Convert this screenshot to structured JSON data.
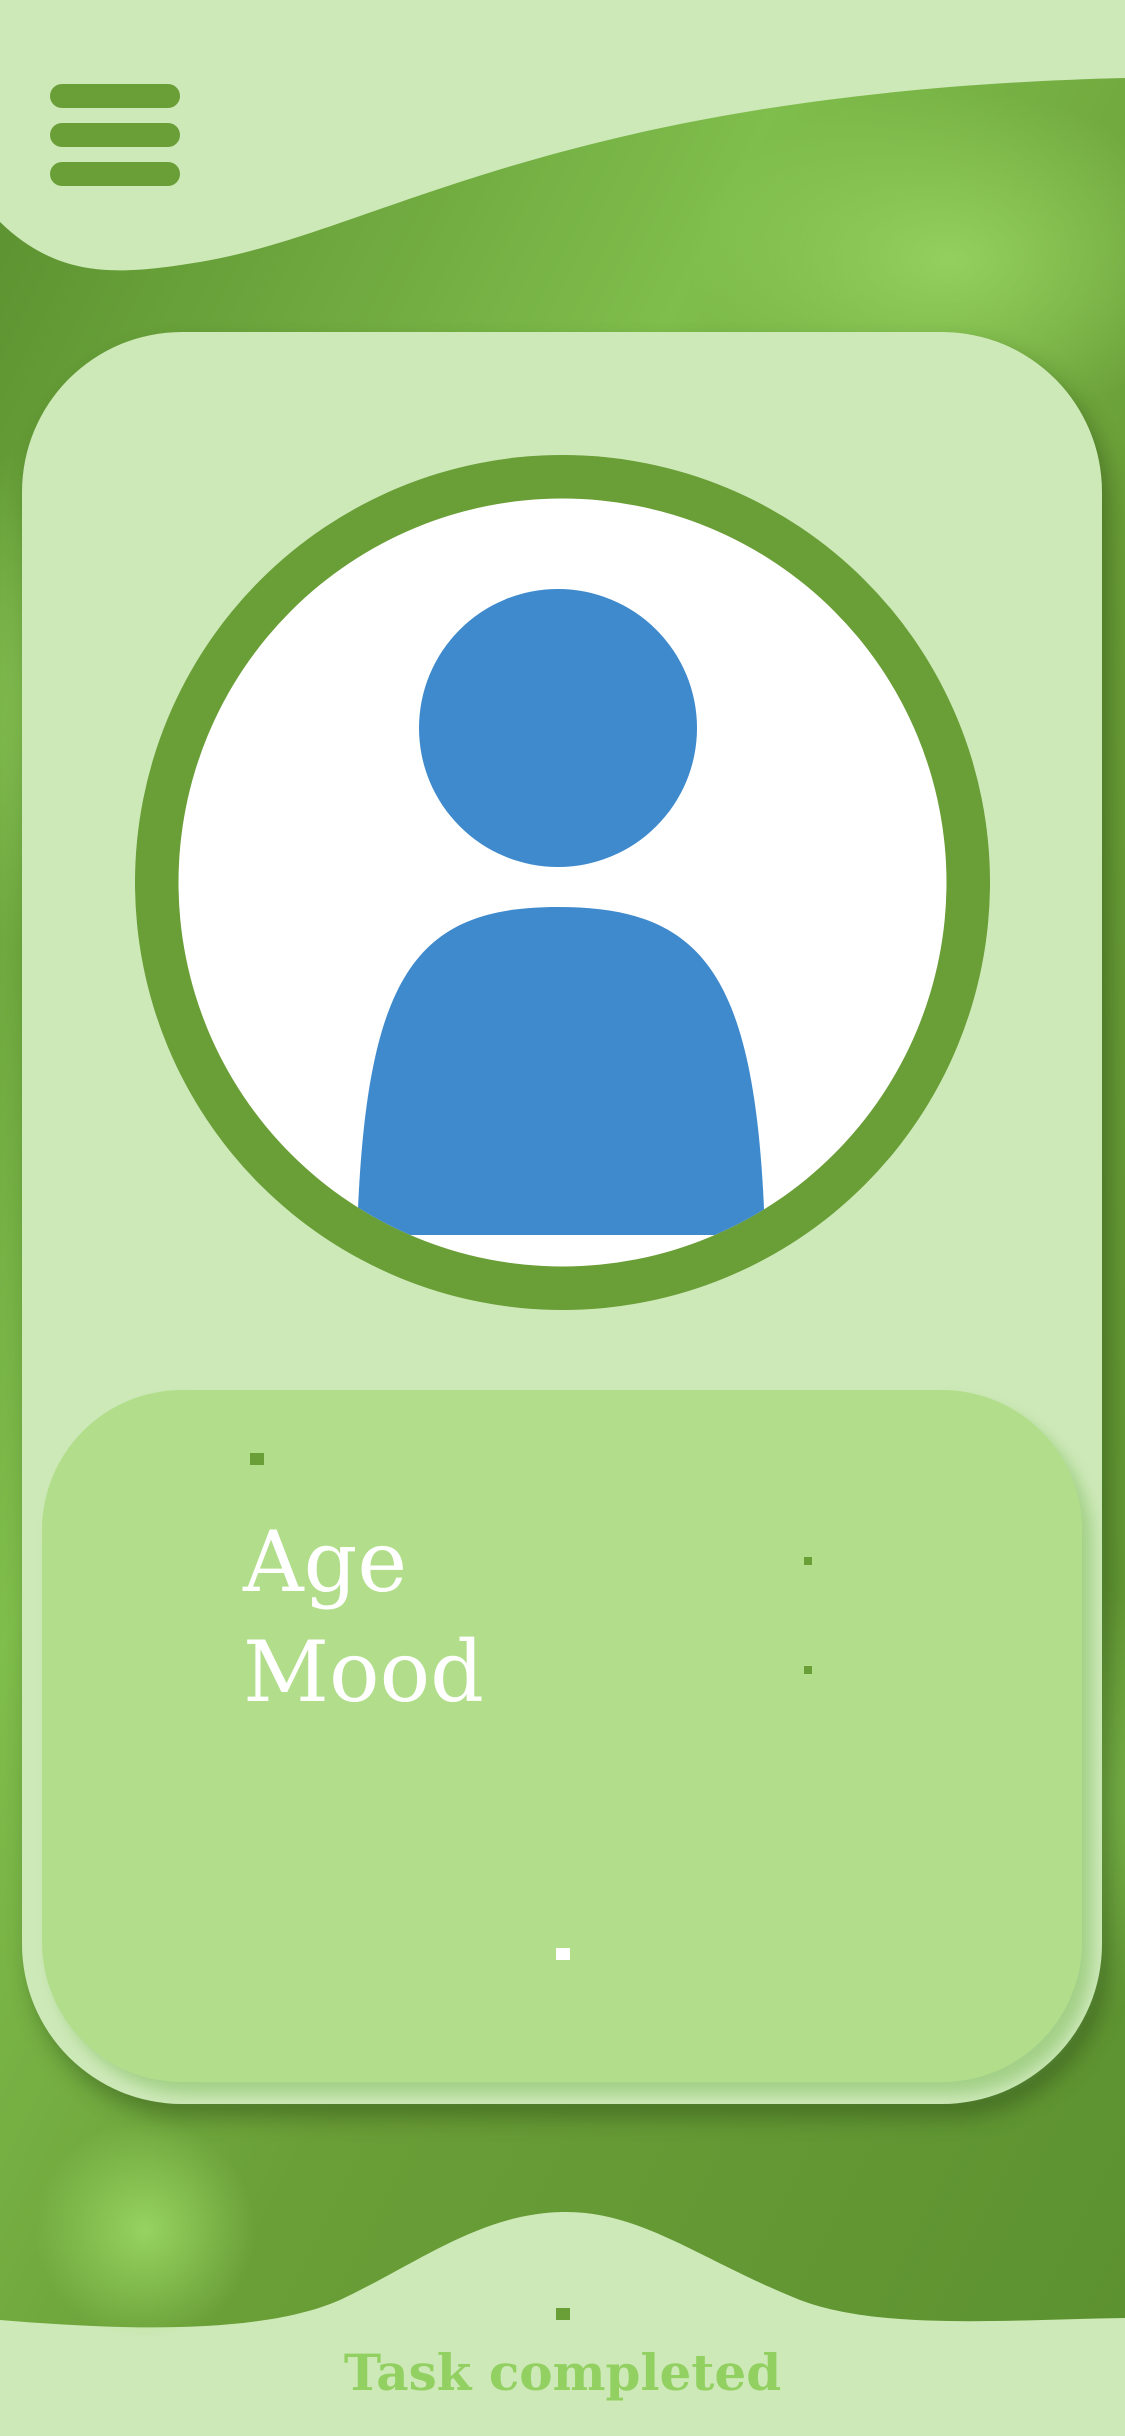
{
  "app": {
    "menu_icon": "hamburger-menu-icon",
    "avatar_icon": "user-avatar-icon"
  },
  "profile": {
    "fields": [
      {
        "label": "Age",
        "value": ""
      },
      {
        "label": "Mood",
        "value": ""
      }
    ]
  },
  "status": {
    "text": "Task completed"
  },
  "colors": {
    "page_background": "#cde9b8",
    "dark_green": "#6a9e37",
    "bright_green": "#92d161",
    "panel_green": "#b2de8c",
    "avatar_blue": "#3f8acd"
  }
}
